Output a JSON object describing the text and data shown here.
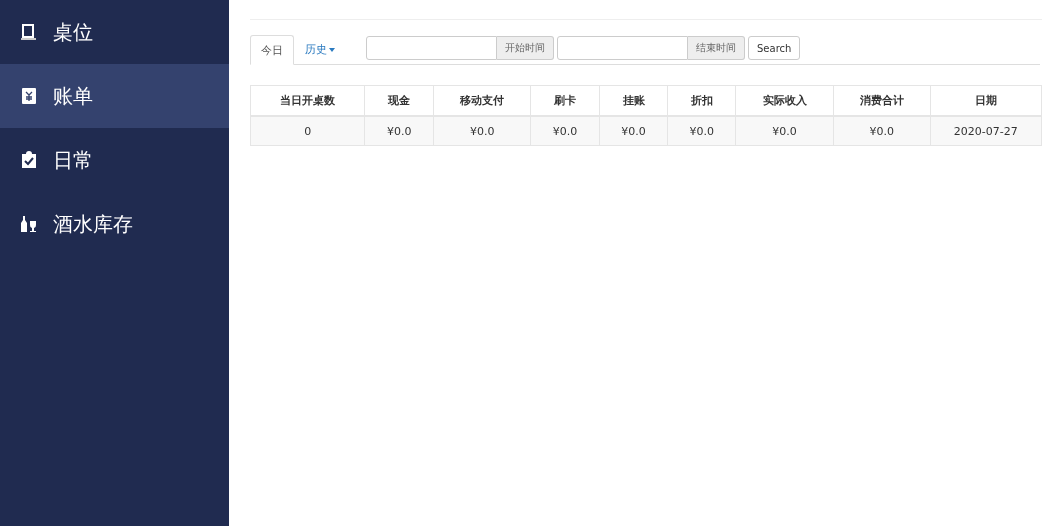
{
  "sidebar": {
    "items": [
      {
        "label": "桌位",
        "kind": "book",
        "selected": false
      },
      {
        "label": "账单",
        "kind": "bill",
        "selected": true
      },
      {
        "label": "日常",
        "kind": "clipboard",
        "selected": false
      },
      {
        "label": "酒水库存",
        "kind": "drinks",
        "selected": false
      }
    ]
  },
  "tabs": [
    {
      "label": "今日",
      "selected": true,
      "dropdown": false
    },
    {
      "label": "历史",
      "selected": false,
      "dropdown": true
    }
  ],
  "filters": [
    {
      "addon": "开始时间"
    },
    {
      "addon": "结束时间"
    }
  ],
  "search_button": "Search",
  "table": {
    "columns": [
      "当日开桌数",
      "现金",
      "移动支付",
      "刷卡",
      "挂账",
      "折扣",
      "实际收入",
      "消费合计",
      "日期"
    ],
    "rows": [
      [
        "0",
        "¥0.0",
        "¥0.0",
        "¥0.0",
        "¥0.0",
        "¥0.0",
        "¥0.0",
        "¥0.0",
        "2020-07-27"
      ]
    ]
  }
}
